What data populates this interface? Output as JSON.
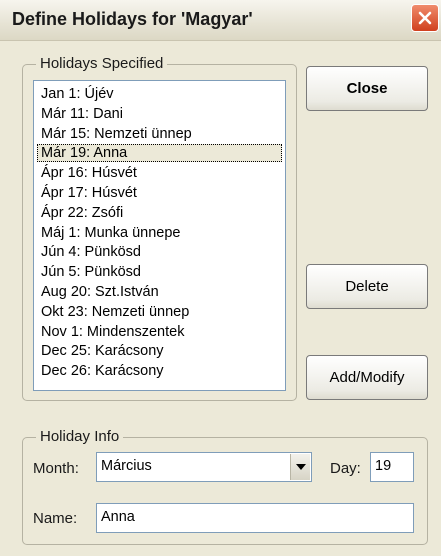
{
  "window": {
    "title": "Define Holidays for 'Magyar'"
  },
  "holidays_group": {
    "legend": "Holidays Specified",
    "items": [
      "Jan 1: Újév",
      "Már 11: Dani",
      "Már 15: Nemzeti ünnep",
      "Már 19: Anna",
      "Ápr 16: Húsvét",
      "Ápr 17: Húsvét",
      "Ápr 22: Zsófi",
      "Máj 1: Munka ünnepe",
      "Jún 4: Pünkösd",
      "Jún 5: Pünkösd",
      "Aug 20: Szt.István",
      "Okt 23: Nemzeti ünnep",
      "Nov 1: Mindenszentek",
      "Dec 25: Karácsony",
      "Dec 26: Karácsony"
    ],
    "selected_index": 3
  },
  "buttons": {
    "close": "Close",
    "delete": "Delete",
    "add_modify": "Add/Modify"
  },
  "holiday_info": {
    "legend": "Holiday Info",
    "month_label": "Month:",
    "month_value": "Március",
    "day_label": "Day:",
    "day_value": "19",
    "name_label": "Name:",
    "name_value": "Anna"
  },
  "icons": {
    "close_window": "close-icon",
    "dropdown": "chevron-down-icon"
  }
}
